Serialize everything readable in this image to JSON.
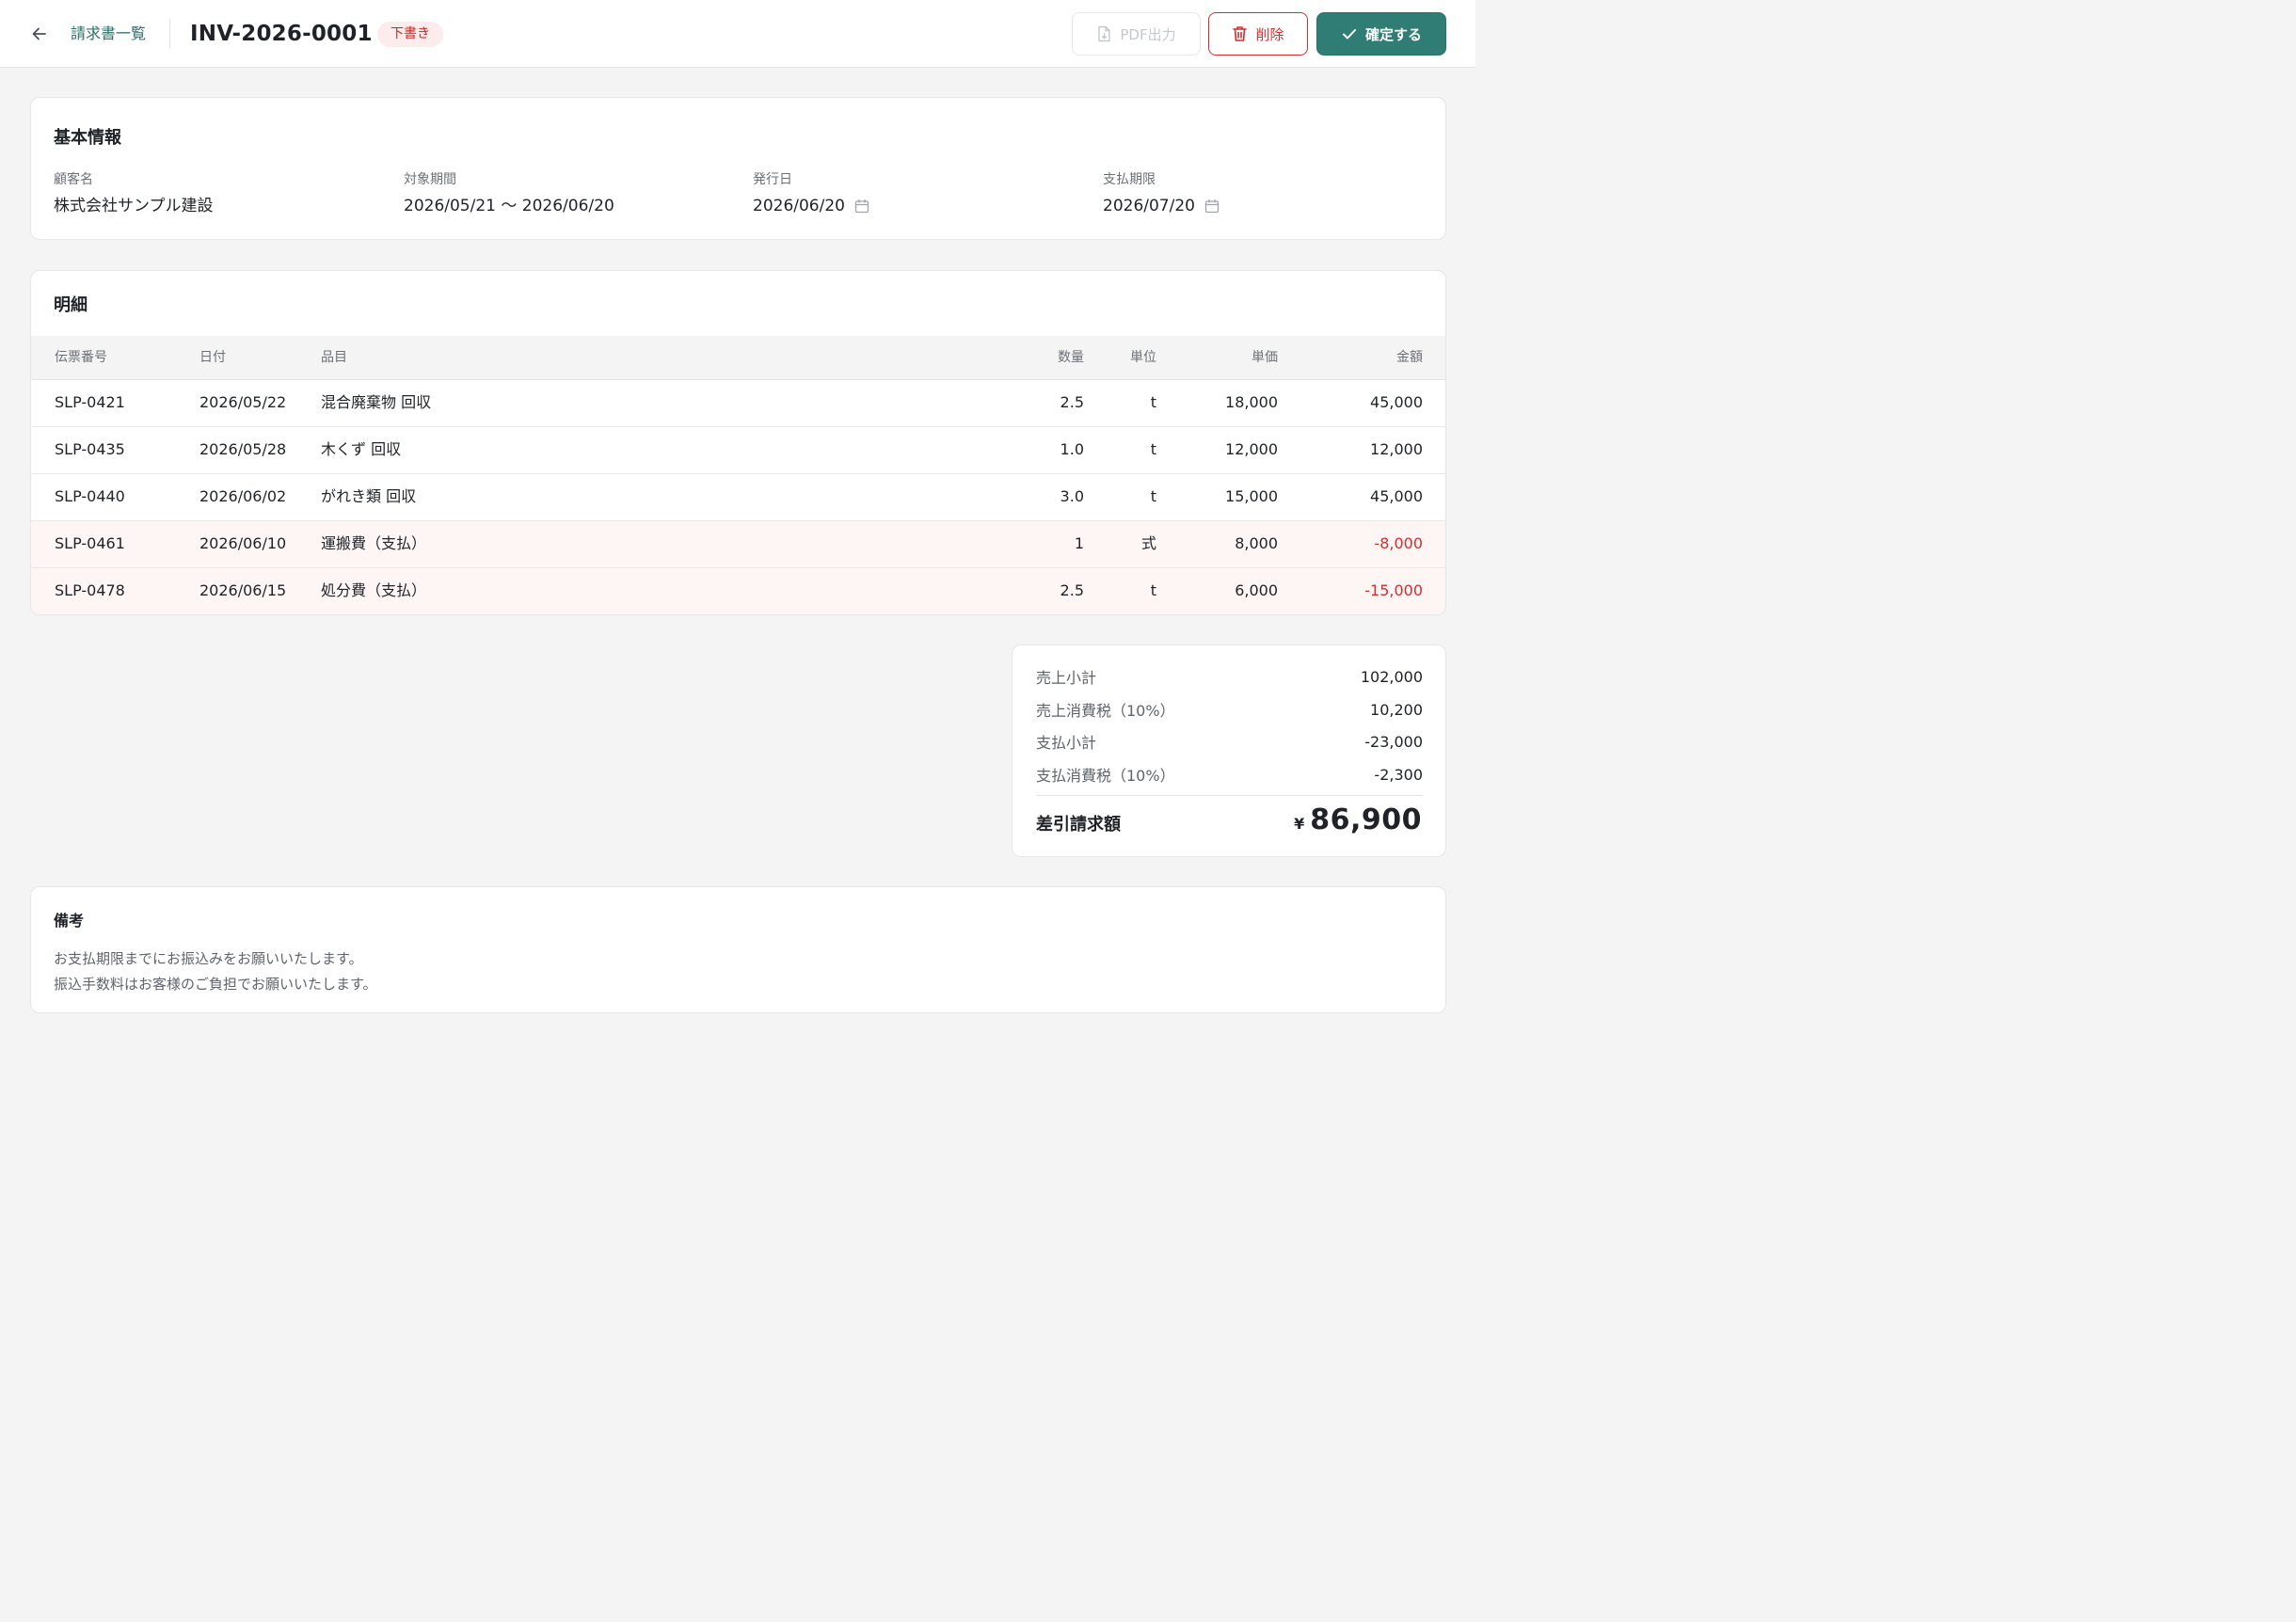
{
  "header": {
    "breadcrumb": "請求書一覧",
    "title": "INV-2026-0001",
    "status": "下書き",
    "pdf_label": "PDF出力",
    "delete_label": "削除",
    "confirm_label": "確定する"
  },
  "info": {
    "title": "基本情報",
    "customer_label": "顧客名",
    "customer": "株式会社サンプル建設",
    "period_label": "対象期間",
    "period": "2026/05/21 〜 2026/06/20",
    "issue_label": "発行日",
    "issue_date": "2026/06/20",
    "due_label": "支払期限",
    "due_date": "2026/07/20"
  },
  "items": {
    "title": "明細",
    "columns": [
      "伝票番号",
      "日付",
      "品目",
      "数量",
      "単位",
      "単価",
      "金額"
    ],
    "rows": [
      {
        "slip": "SLP-0421",
        "date": "2026/05/22",
        "item": "混合廃棄物 回収",
        "qty": "2.5",
        "unit": "t",
        "price": "18,000",
        "amount": "45,000"
      },
      {
        "slip": "SLP-0435",
        "date": "2026/05/28",
        "item": "木くず 回収",
        "qty": "1.0",
        "unit": "t",
        "price": "12,000",
        "amount": "12,000"
      },
      {
        "slip": "SLP-0440",
        "date": "2026/06/02",
        "item": "がれき類 回収",
        "qty": "3.0",
        "unit": "t",
        "price": "15,000",
        "amount": "45,000"
      },
      {
        "slip": "SLP-0461",
        "date": "2026/06/10",
        "item": "運搬費（支払）",
        "qty": "1",
        "unit": "式",
        "price": "8,000",
        "amount": "-8,000"
      },
      {
        "slip": "SLP-0478",
        "date": "2026/06/15",
        "item": "処分費（支払）",
        "qty": "2.5",
        "unit": "t",
        "price": "6,000",
        "amount": "-15,000"
      }
    ]
  },
  "totals": {
    "sales_subtotal_label": "売上小計",
    "sales_subtotal": "102,000",
    "sales_tax_label": "売上消費税（10%）",
    "sales_tax": "10,200",
    "pay_subtotal_label": "支払小計",
    "pay_subtotal": "-23,000",
    "pay_tax_label": "支払消費税（10%）",
    "pay_tax": "-2,300",
    "grand_label": "差引請求額",
    "currency": "¥",
    "grand_total": "86,900"
  },
  "notes": {
    "title": "備考",
    "line1": "お支払期限までにお振込みをお願いいたします。",
    "line2": "振込手数料はお客様のご負担でお願いいたします。"
  },
  "colors": {
    "accent": "#2f7d74",
    "danger": "#d32f2f",
    "draft_badge_bg": "#fdecec",
    "payment_row_bg": "#fdf6f5"
  }
}
